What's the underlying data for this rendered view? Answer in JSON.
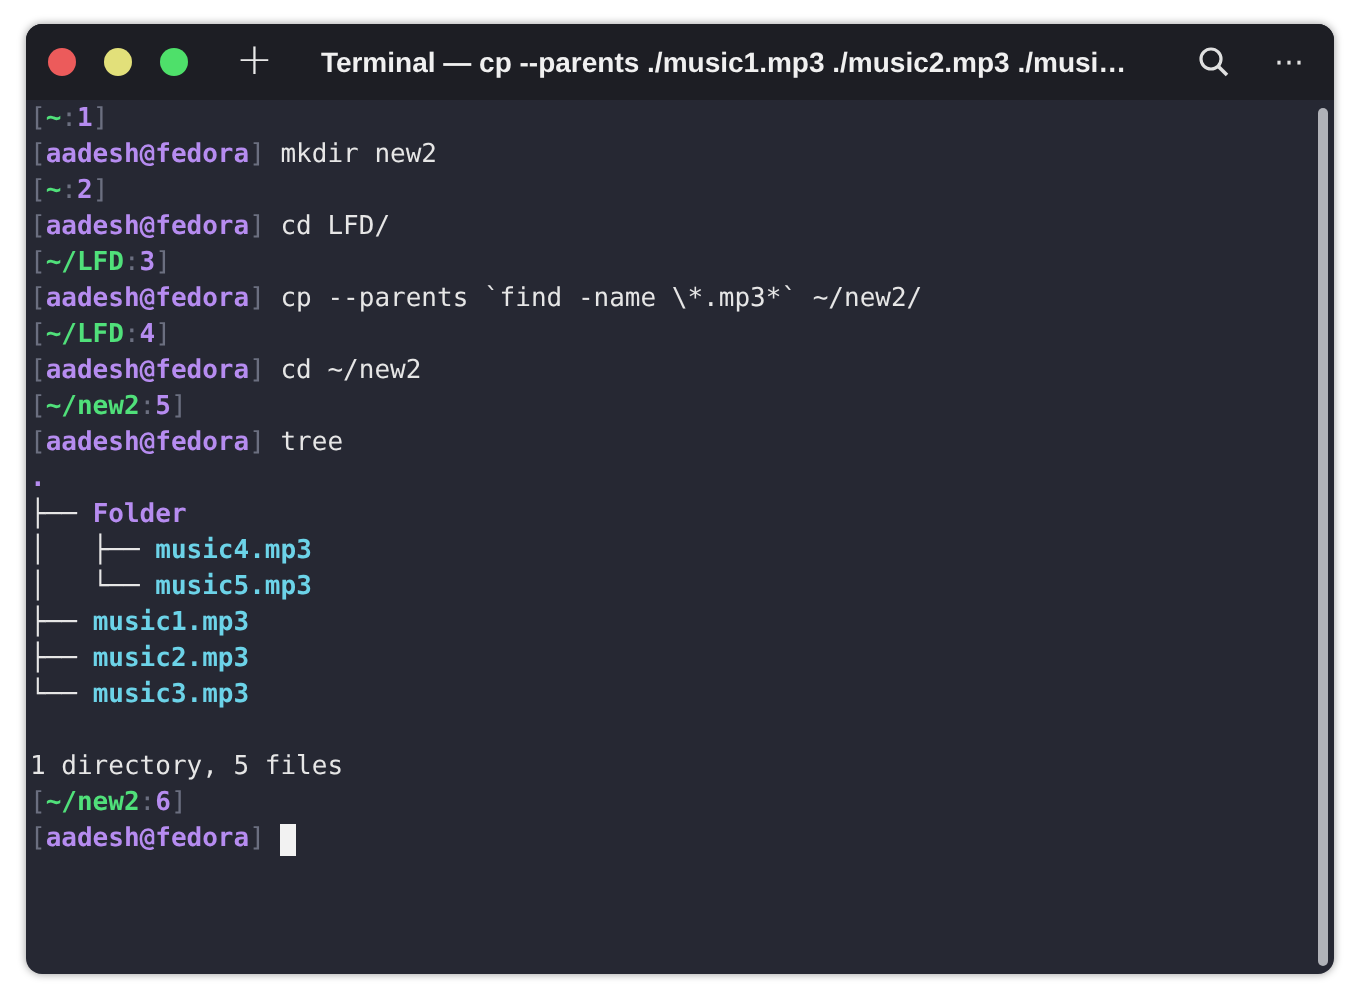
{
  "window": {
    "title": "Terminal — cp --parents ./music1.mp3 ./music2.mp3 ./musi…",
    "new_tab": "+",
    "menu": "⋯"
  },
  "lines": [
    {
      "kind": "dir_prompt",
      "open": "[",
      "path": "~",
      "sep": ":",
      "number": "1",
      "close": "]"
    },
    {
      "kind": "user_prompt",
      "open": "[",
      "user": "aadesh@fedora",
      "close": "]",
      "command": "mkdir new2"
    },
    {
      "kind": "dir_prompt",
      "open": "[",
      "path": "~",
      "sep": ":",
      "number": "2",
      "close": "]"
    },
    {
      "kind": "user_prompt",
      "open": "[",
      "user": "aadesh@fedora",
      "close": "]",
      "command": "cd LFD/"
    },
    {
      "kind": "dir_prompt",
      "open": "[",
      "path": "~/LFD",
      "sep": ":",
      "number": "3",
      "close": "]"
    },
    {
      "kind": "user_prompt",
      "open": "[",
      "user": "aadesh@fedora",
      "close": "]",
      "command": "cp --parents `find -name \\*.mp3*` ~/new2/"
    },
    {
      "kind": "dir_prompt",
      "open": "[",
      "path": "~/LFD",
      "sep": ":",
      "number": "4",
      "close": "]"
    },
    {
      "kind": "user_prompt",
      "open": "[",
      "user": "aadesh@fedora",
      "close": "]",
      "command": "cd ~/new2"
    },
    {
      "kind": "dir_prompt",
      "open": "[",
      "path": "~/new2",
      "sep": ":",
      "number": "5",
      "close": "]"
    },
    {
      "kind": "user_prompt",
      "open": "[",
      "user": "aadesh@fedora",
      "close": "]",
      "command": "tree"
    },
    {
      "kind": "tree_dir",
      "name": "."
    },
    {
      "kind": "tree_dir",
      "prefix": "├── ",
      "name": "Folder"
    },
    {
      "kind": "tree_file",
      "prefix": "│   ├── ",
      "name": "music4.mp3"
    },
    {
      "kind": "tree_file",
      "prefix": "│   └── ",
      "name": "music5.mp3"
    },
    {
      "kind": "tree_file",
      "prefix": "├── ",
      "name": "music1.mp3"
    },
    {
      "kind": "tree_file",
      "prefix": "├── ",
      "name": "music2.mp3"
    },
    {
      "kind": "tree_file",
      "prefix": "└── ",
      "name": "music3.mp3"
    },
    {
      "kind": "blank"
    },
    {
      "kind": "output",
      "text": "1 directory, 5 files"
    },
    {
      "kind": "dir_prompt",
      "open": "[",
      "path": "~/new2",
      "sep": ":",
      "number": "6",
      "close": "]"
    },
    {
      "kind": "user_prompt",
      "open": "[",
      "user": "aadesh@fedora",
      "close": "]",
      "cursor": true
    }
  ]
}
